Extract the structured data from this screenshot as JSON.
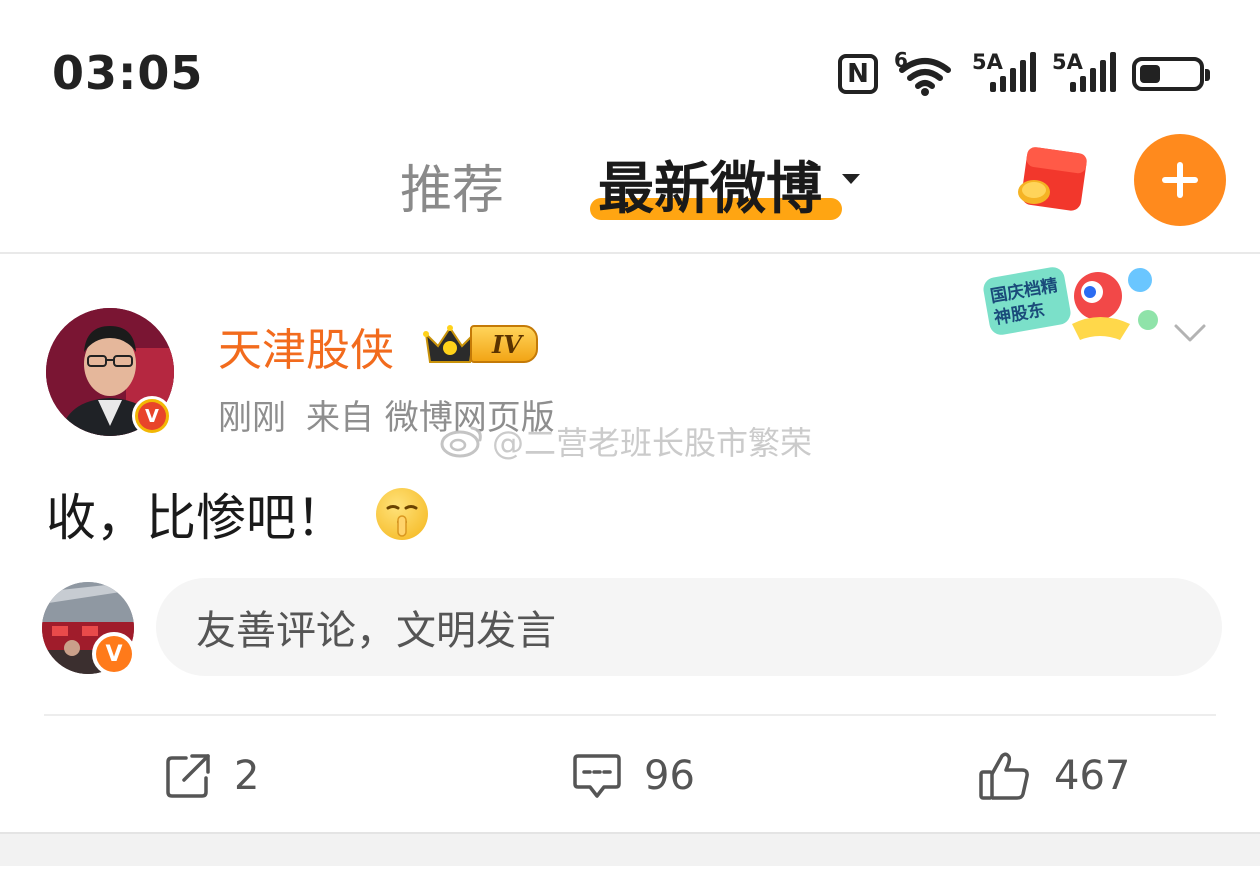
{
  "status_bar": {
    "time": "03:05",
    "wifi_label": "6",
    "sim1_label": "5A",
    "sim2_label": "5A",
    "battery_level": 0.35
  },
  "nav": {
    "tab_recommended": "推荐",
    "tab_latest": "最新微博",
    "accent_color": "#ff8a1d"
  },
  "post": {
    "author": "天津股侠",
    "level": "IV",
    "time": "刚刚",
    "source": "来自 微博网页版",
    "watermark": "@二营老班长股市繁荣",
    "text": "收，比惨吧！",
    "name_color": "#f26b1d",
    "holiday_sticker_text": "国庆档精神股东"
  },
  "comment": {
    "placeholder": "友善评论，文明发言"
  },
  "actions": {
    "repost_count": "2",
    "comment_count": "96",
    "like_count": "467"
  }
}
